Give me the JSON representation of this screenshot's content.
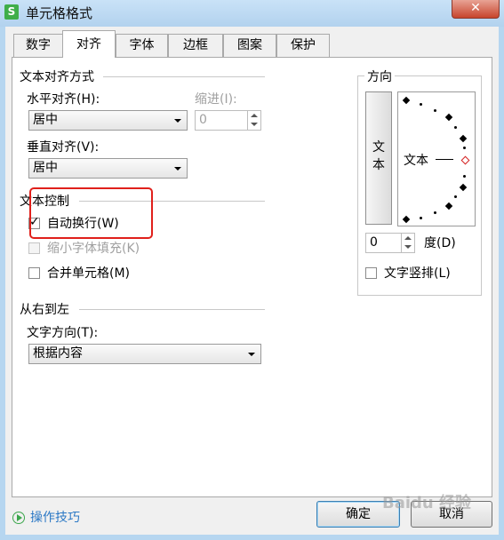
{
  "window": {
    "title": "单元格格式",
    "close_label": "✕",
    "app_icon_letter": "S"
  },
  "tabs": [
    {
      "label": "数字",
      "active": false
    },
    {
      "label": "对齐",
      "active": true
    },
    {
      "label": "字体",
      "active": false
    },
    {
      "label": "边框",
      "active": false
    },
    {
      "label": "图案",
      "active": false
    },
    {
      "label": "保护",
      "active": false
    }
  ],
  "text_alignment": {
    "section_title": "文本对齐方式",
    "horizontal_label": "水平对齐(H):",
    "horizontal_value": "居中",
    "indent_label": "缩进(I):",
    "indent_value": "0",
    "vertical_label": "垂直对齐(V):",
    "vertical_value": "居中"
  },
  "text_control": {
    "section_title": "文本控制",
    "wrap_text": {
      "label": "自动换行(W)",
      "checked": true
    },
    "shrink_to_fit": {
      "label": "缩小字体填充(K)",
      "checked": false,
      "disabled": true
    },
    "merge_cells": {
      "label": "合并单元格(M)",
      "checked": false
    }
  },
  "rtl": {
    "section_title": "从右到左",
    "direction_label": "文字方向(T):",
    "direction_value": "根据内容"
  },
  "orientation": {
    "section_title": "方向",
    "vertical_text_button": "文本",
    "dial_text": "文本",
    "degree_value": "0",
    "degree_label": "度(D)",
    "vertical_layout": {
      "label": "文字竖排(L)",
      "checked": false
    }
  },
  "footer": {
    "tips_label": "操作技巧",
    "ok_label": "确定",
    "cancel_label": "取消",
    "watermark": "Baidu 经验"
  },
  "colors": {
    "highlight": "#e0201b",
    "tips_link": "#2b78c5",
    "dial_marker": "#d42020"
  }
}
